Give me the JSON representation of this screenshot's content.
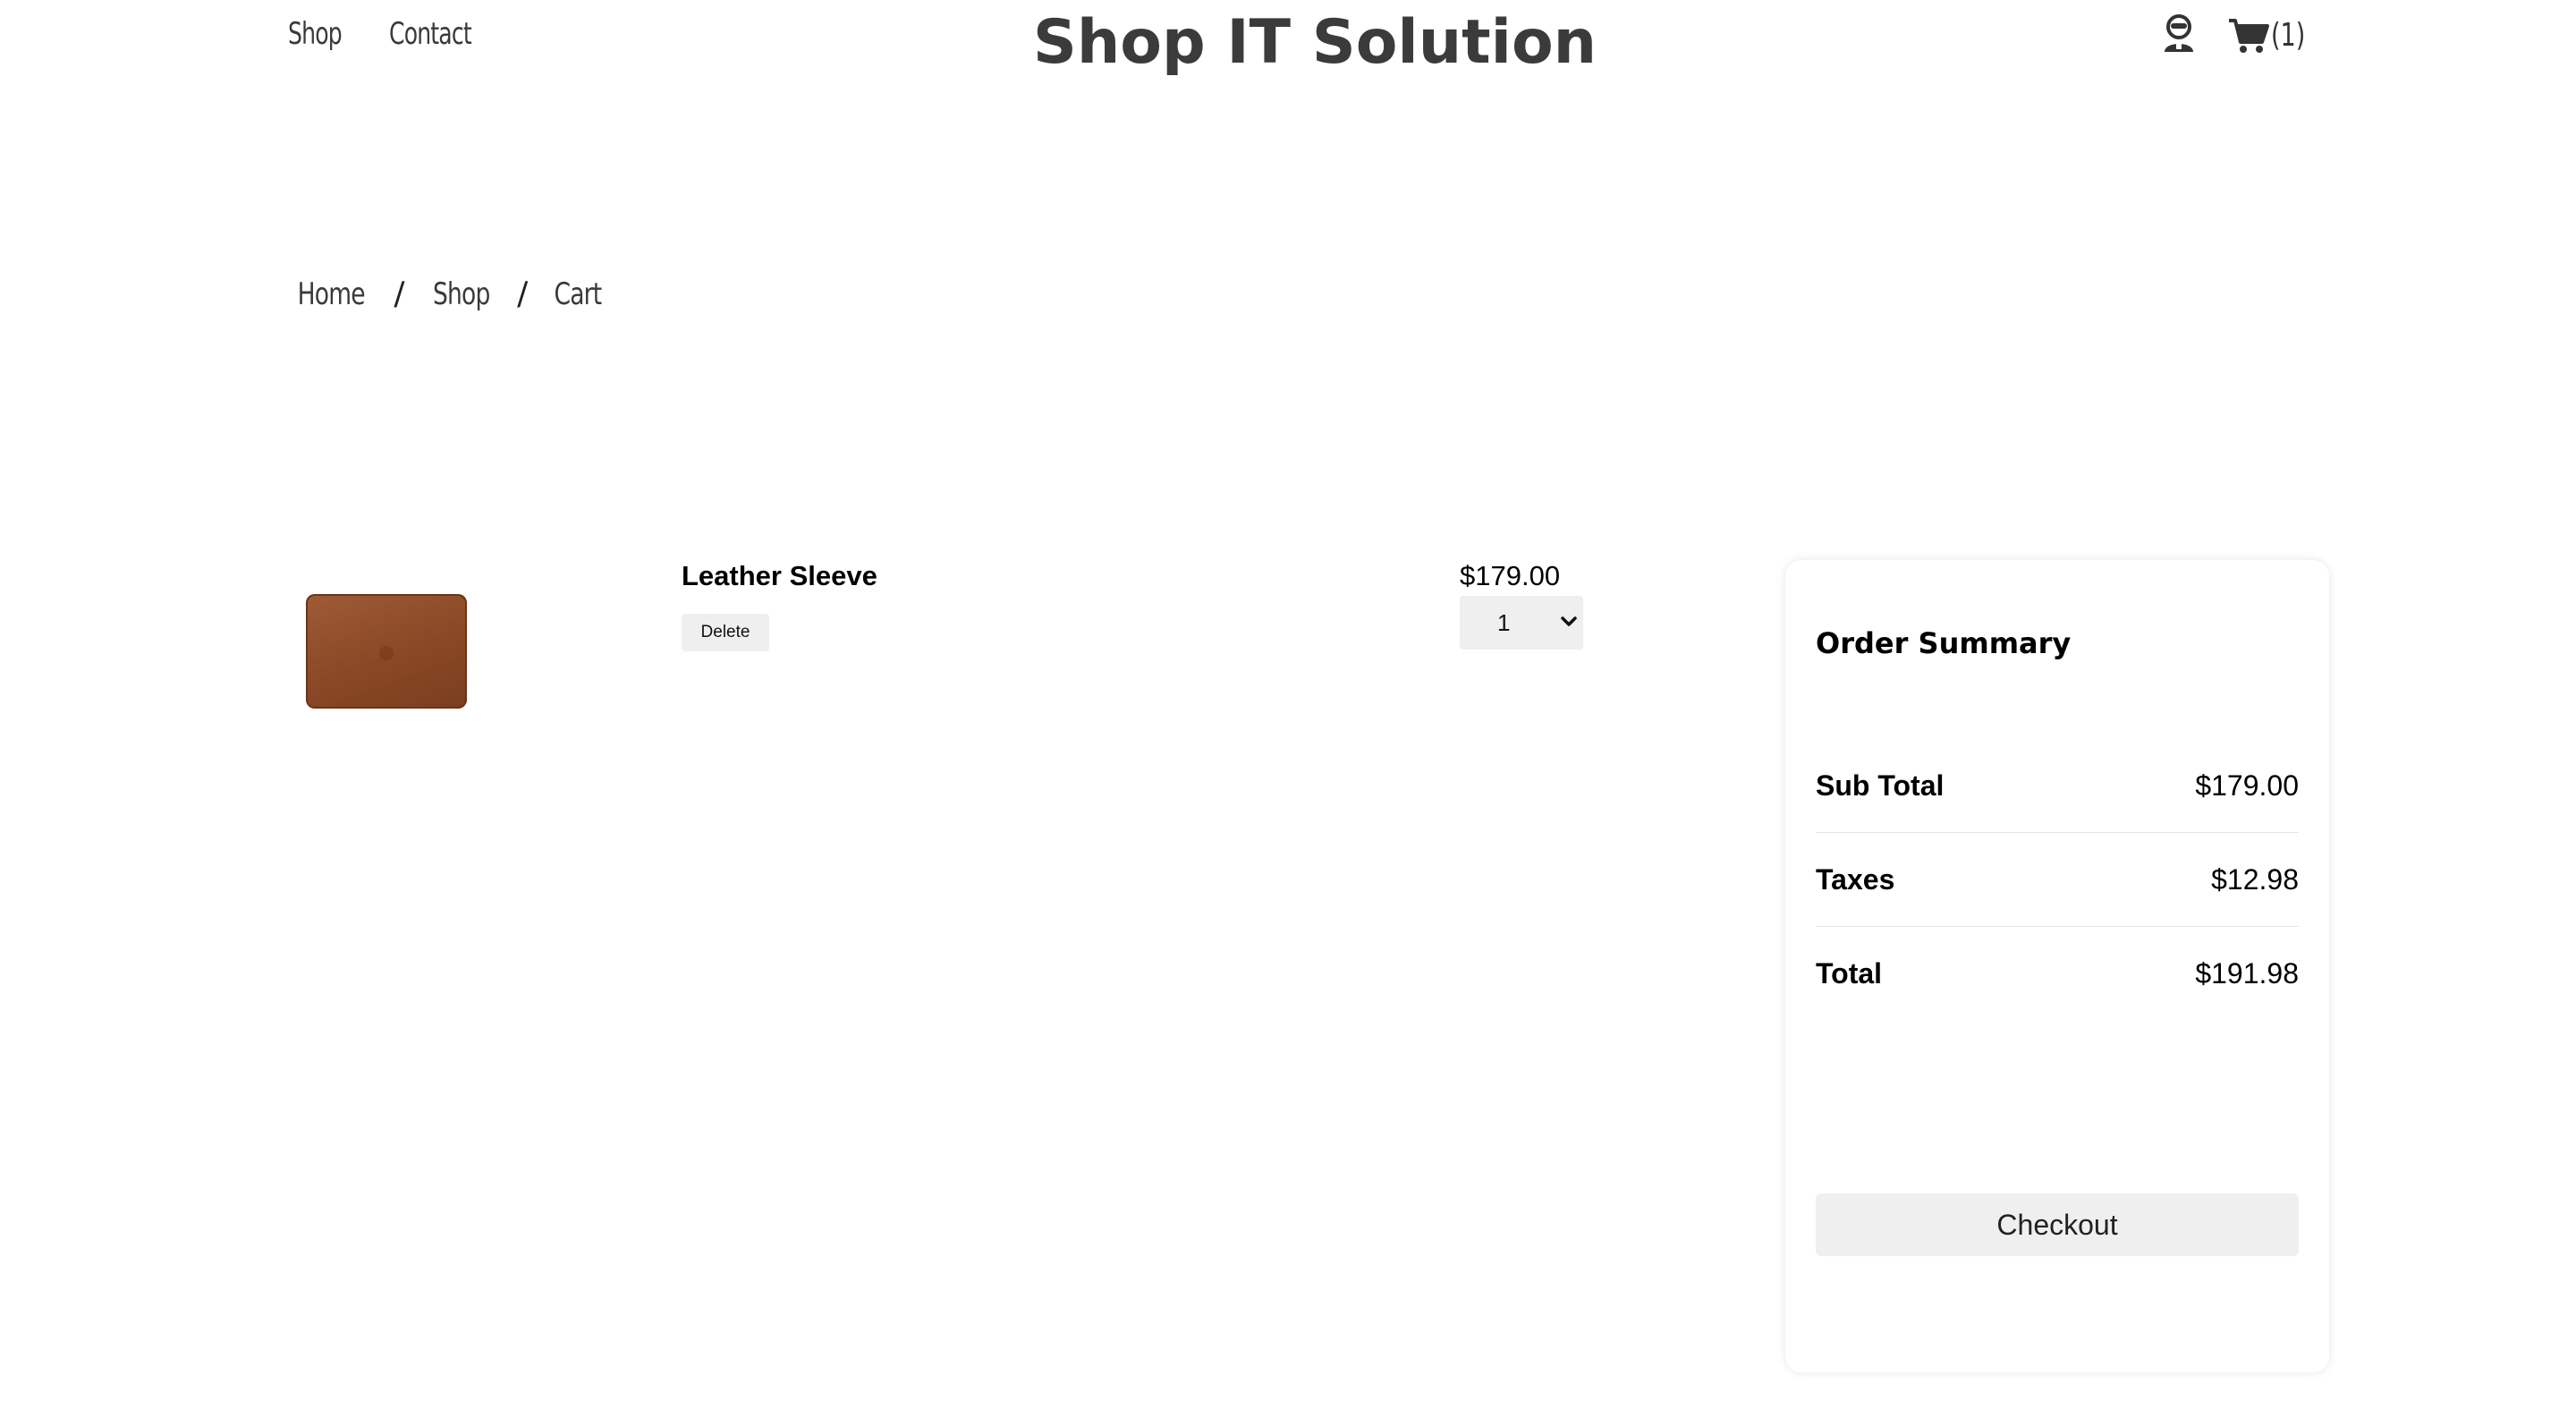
{
  "header": {
    "nav": [
      {
        "label": "Shop"
      },
      {
        "label": "Contact"
      }
    ],
    "title": "Shop IT Solution",
    "cart_count": "(1)",
    "icons": [
      "user-icon",
      "cart-icon"
    ]
  },
  "breadcrumb": {
    "items": [
      "Home",
      "Shop",
      "Cart"
    ],
    "separator": "/"
  },
  "cart": {
    "items": [
      {
        "name": "Leather Sleeve",
        "delete_label": "Delete",
        "price": "$179.00",
        "quantity": "1",
        "image_color": "#8a4826"
      }
    ]
  },
  "summary": {
    "title": "Order Summary",
    "rows": [
      {
        "label": "Sub Total",
        "value": "$179.00"
      },
      {
        "label": "Taxes",
        "value": "$12.98"
      },
      {
        "label": "Total",
        "value": "$191.98"
      }
    ],
    "checkout_label": "Checkout"
  },
  "colors": {
    "title": "#3b3b3b",
    "button_bg": "#efefef",
    "divider": "#e6e6e6"
  }
}
